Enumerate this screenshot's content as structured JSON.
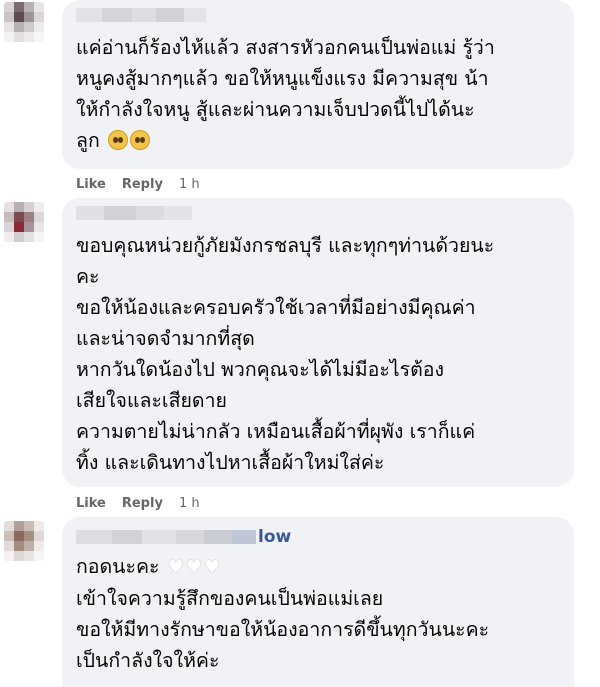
{
  "comments": [
    {
      "lines": [
        "แค่อ่านก็ร้องไห้แล้ว สงสารหัวอกคนเป็นพ่อแม่ รู้ว่า",
        "หนูคงสู้มากๆแล้ว ขอให้หนูแข็งแรง มีความสุข น้า",
        "ให้กำลังใจหนู สู้และผ่านความเจ็บปวดนี้ไปได้นะ",
        "ลูก"
      ],
      "like_label": "Like",
      "reply_label": "Reply",
      "time": "1 h"
    },
    {
      "lines": [
        "ขอบคุณหน่วยกู้ภัยมังกรชลบุรี และทุกๆท่านด้วยนะ",
        "คะ",
        "ขอให้น้องและครอบครัวใช้เวลาที่มีอย่างมีคุณค่า",
        "และน่าจดจำมากที่สุด",
        "หากวันใดน้องไป พวกคุณจะได้ไม่มีอะไรต้อง",
        "เสียใจและเสียดาย",
        "ความตายไม่น่ากลัว เหมือนเสื้อผ้าที่ผุพัง เราก็แค่",
        "ทิ้ง และเดินทางไปหาเสื้อผ้าใหม่ใส่ค่ะ"
      ],
      "like_label": "Like",
      "reply_label": "Reply",
      "time": "1 h"
    },
    {
      "name_suffix": "low",
      "lines": [
        "กอดนะคะ",
        "เข้าใจความรู้สึกของคนเป็นพ่อแม่เลย",
        "ขอให้มีทางรักษาขอให้น้องอาการดีขึ้นทุกวันนะคะ",
        "เป็นกำลังใจให้ค่ะ"
      ]
    }
  ],
  "colors": {
    "bubble": "#f0f2f5",
    "meta": "#65676b",
    "link": "#385898"
  },
  "icons": [
    "pleading-face-emoji",
    "white-heart-emoji"
  ]
}
